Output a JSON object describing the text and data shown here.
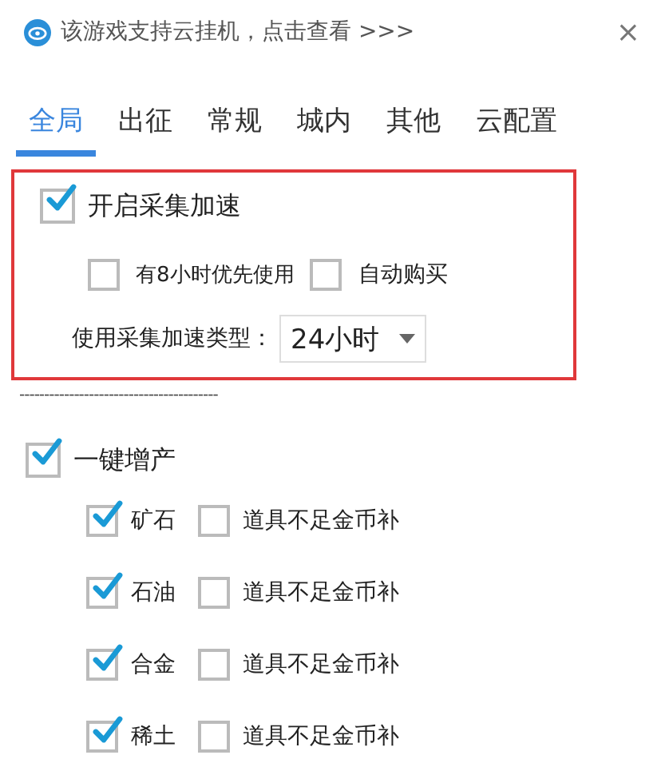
{
  "banner": {
    "text": "该游戏支持云挂机，点击查看 >>>",
    "close": "×"
  },
  "tabs": [
    {
      "label": "全局",
      "selected": true
    },
    {
      "label": "出征",
      "selected": false
    },
    {
      "label": "常规",
      "selected": false
    },
    {
      "label": "城内",
      "selected": false
    },
    {
      "label": "其他",
      "selected": false
    },
    {
      "label": "云配置",
      "selected": false
    }
  ],
  "gather_boost": {
    "label": "开启采集加速",
    "checked": true,
    "options": [
      {
        "label": "有8小时优先使用",
        "checked": false
      },
      {
        "label": "自动购买",
        "checked": false
      }
    ],
    "type_label": "使用采集加速类型：",
    "type_value": "24小时"
  },
  "separator": "----------------------------------------",
  "boost_production": {
    "label": "一键增产",
    "checked": true,
    "items": [
      {
        "label": "矿石",
        "checked": true,
        "fallback": {
          "label": "道具不足金币补",
          "checked": false
        }
      },
      {
        "label": "石油",
        "checked": true,
        "fallback": {
          "label": "道具不足金币补",
          "checked": false
        }
      },
      {
        "label": "合金",
        "checked": true,
        "fallback": {
          "label": "道具不足金币补",
          "checked": false
        }
      },
      {
        "label": "稀土",
        "checked": true,
        "fallback": {
          "label": "道具不足金币补",
          "checked": false
        }
      }
    ]
  }
}
